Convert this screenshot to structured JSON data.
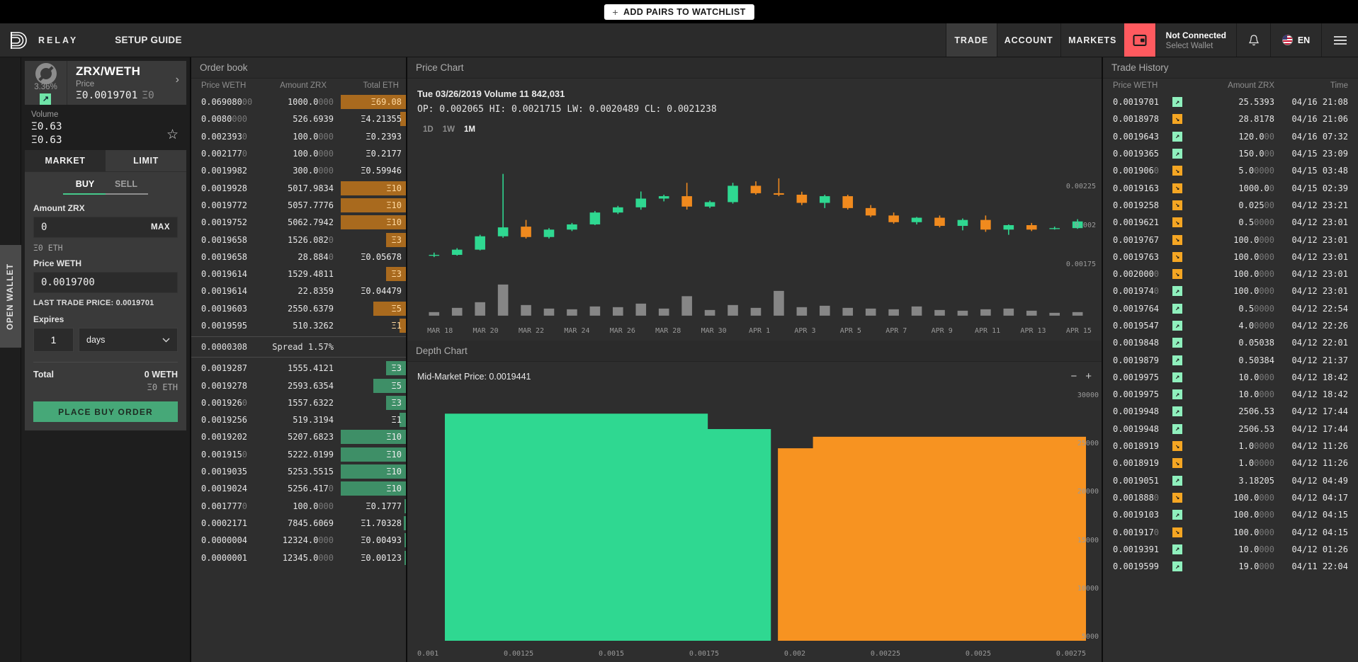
{
  "topstrip": {
    "add_pairs_label": "ADD PAIRS TO WATCHLIST",
    "plus_icon": "+"
  },
  "header": {
    "brand": "RELAY",
    "setup_guide": "SETUP GUIDE",
    "nav": [
      {
        "label": "TRADE",
        "active": true
      },
      {
        "label": "ACCOUNT",
        "active": false
      },
      {
        "label": "MARKETS",
        "active": false
      }
    ],
    "wallet_icon": "wallet-icon",
    "wallet_status_line1": "Not Connected",
    "wallet_status_line2": "Select Wallet",
    "bell_icon": "bell-icon",
    "lang": "EN",
    "menu_icon": "hamburger-icon",
    "accent_wallet": "#ff5a5f"
  },
  "rail": {
    "open_wallet": "OPEN WALLET"
  },
  "left": {
    "pair": {
      "name": "ZRX/WETH",
      "chevron": "›",
      "change_pct": "3.36%",
      "change_arrow": "↗",
      "price_label": "Price",
      "price_value": "Ξ0.0019701",
      "price_secondary": "Ξ0"
    },
    "volume": {
      "label": "Volume",
      "v1": "Ξ0.63",
      "v2": "Ξ0.63",
      "star_icon": "☆"
    },
    "mode_tabs": [
      {
        "label": "MARKET",
        "active": false
      },
      {
        "label": "LIMIT",
        "active": true
      }
    ],
    "side_tabs": [
      {
        "label": "BUY",
        "active": true
      },
      {
        "label": "SELL",
        "active": false
      }
    ],
    "amount_label": "Amount ZRX",
    "amount_value": "0",
    "max_label": "MAX",
    "amount_eth_sub": "Ξ0 ETH",
    "price_label": "Price WETH",
    "price_value": "0.0019700",
    "last_trade_price": "LAST TRADE PRICE: 0.0019701",
    "expires_label": "Expires",
    "expires_value": "1",
    "expires_unit": "days",
    "expires_chevron": "⌄",
    "total_label": "Total",
    "total_value": "0 WETH",
    "total_eth": "Ξ0 ETH",
    "place_order": "PLACE BUY ORDER"
  },
  "orderbook": {
    "title": "Order book",
    "columns": [
      "Price WETH",
      "Amount ZRX",
      "Total ETH"
    ],
    "spread": {
      "price": "0.0000308",
      "text": "Spread 1.57%"
    },
    "asks": [
      {
        "price": "0.069080",
        "price_dim": "00",
        "amount": "1000.0",
        "amount_dim": "000",
        "total": "Ξ69.08",
        "bar": 100
      },
      {
        "price": "0.0080",
        "price_dim": "000",
        "amount": "526.6939",
        "amount_dim": "",
        "total": "Ξ4.21355",
        "bar": 9
      },
      {
        "price": "0.002393",
        "price_dim": "0",
        "amount": "100.0",
        "amount_dim": "000",
        "total": "Ξ0.2393",
        "bar": 0
      },
      {
        "price": "0.002177",
        "price_dim": "0",
        "amount": "100.0",
        "amount_dim": "000",
        "total": "Ξ0.2177",
        "bar": 0
      },
      {
        "price": "0.0019982",
        "price_dim": "",
        "amount": "300.0",
        "amount_dim": "000",
        "total": "Ξ0.59946",
        "bar": 0
      },
      {
        "price": "0.0019928",
        "price_dim": "",
        "amount": "5017.9834",
        "amount_dim": "",
        "total": "Ξ10",
        "bar": 100
      },
      {
        "price": "0.0019772",
        "price_dim": "",
        "amount": "5057.7776",
        "amount_dim": "",
        "total": "Ξ10",
        "bar": 100
      },
      {
        "price": "0.0019752",
        "price_dim": "",
        "amount": "5062.7942",
        "amount_dim": "",
        "total": "Ξ10",
        "bar": 100
      },
      {
        "price": "0.0019658",
        "price_dim": "",
        "amount": "1526.082",
        "amount_dim": "0",
        "total": "Ξ3",
        "bar": 30
      },
      {
        "price": "0.0019658",
        "price_dim": "",
        "amount": "28.884",
        "amount_dim": "0",
        "total": "Ξ0.05678",
        "bar": 0
      },
      {
        "price": "0.0019614",
        "price_dim": "",
        "amount": "1529.4811",
        "amount_dim": "",
        "total": "Ξ3",
        "bar": 30
      },
      {
        "price": "0.0019614",
        "price_dim": "",
        "amount": "22.8359",
        "amount_dim": "",
        "total": "Ξ0.04479",
        "bar": 0
      },
      {
        "price": "0.0019603",
        "price_dim": "",
        "amount": "2550.6379",
        "amount_dim": "",
        "total": "Ξ5",
        "bar": 50
      },
      {
        "price": "0.0019595",
        "price_dim": "",
        "amount": "510.3262",
        "amount_dim": "",
        "total": "Ξ1",
        "bar": 10
      }
    ],
    "bids": [
      {
        "price": "0.0019287",
        "price_dim": "",
        "amount": "1555.4121",
        "amount_dim": "",
        "total": "Ξ3",
        "bar": 30
      },
      {
        "price": "0.0019278",
        "price_dim": "",
        "amount": "2593.6354",
        "amount_dim": "",
        "total": "Ξ5",
        "bar": 50
      },
      {
        "price": "0.001926",
        "price_dim": "0",
        "amount": "1557.6322",
        "amount_dim": "",
        "total": "Ξ3",
        "bar": 30
      },
      {
        "price": "0.0019256",
        "price_dim": "",
        "amount": "519.3194",
        "amount_dim": "",
        "total": "Ξ1",
        "bar": 10
      },
      {
        "price": "0.0019202",
        "price_dim": "",
        "amount": "5207.6823",
        "amount_dim": "",
        "total": "Ξ10",
        "bar": 100
      },
      {
        "price": "0.001915",
        "price_dim": "0",
        "amount": "5222.0199",
        "amount_dim": "",
        "total": "Ξ10",
        "bar": 100
      },
      {
        "price": "0.0019035",
        "price_dim": "",
        "amount": "5253.5515",
        "amount_dim": "",
        "total": "Ξ10",
        "bar": 100
      },
      {
        "price": "0.0019024",
        "price_dim": "",
        "amount": "5256.417",
        "amount_dim": "0",
        "total": "Ξ10",
        "bar": 100
      },
      {
        "price": "0.001777",
        "price_dim": "0",
        "amount": "100.0",
        "amount_dim": "000",
        "total": "Ξ0.1777",
        "bar": 2
      },
      {
        "price": "0.0002171",
        "price_dim": "",
        "amount": "7845.6069",
        "amount_dim": "",
        "total": "Ξ1.70328",
        "bar": 3
      },
      {
        "price": "0.0000004",
        "price_dim": "",
        "amount": "12324.0",
        "amount_dim": "000",
        "total": "Ξ0.00493",
        "bar": 2
      },
      {
        "price": "0.0000001",
        "price_dim": "",
        "amount": "12345.0",
        "amount_dim": "000",
        "total": "Ξ0.00123",
        "bar": 2
      }
    ]
  },
  "pricechart": {
    "title": "Price Chart",
    "info_line1": "Tue 03/26/2019 Volume 11 842,031",
    "info_line2": "OP: 0.002065 HI: 0.0021715 LW: 0.0020489 CL: 0.0021238",
    "timeframes": [
      {
        "label": "1D",
        "active": false
      },
      {
        "label": "1W",
        "active": false
      },
      {
        "label": "1M",
        "active": true
      }
    ]
  },
  "depthchart": {
    "title": "Depth Chart",
    "mid_market": "Mid-Market Price: 0.0019441",
    "zoom_out": "−",
    "zoom_in": "+"
  },
  "tradehistory": {
    "title": "Trade History",
    "columns": [
      "Price WETH",
      "Amount ZRX",
      "Time"
    ],
    "rows": [
      {
        "price": "0.0019701",
        "price_dim": "",
        "dir": "up",
        "amount": "25.5393",
        "amount_dim": "",
        "time": "04/16 21:08"
      },
      {
        "price": "0.0018978",
        "price_dim": "",
        "dir": "down",
        "amount": "28.8178",
        "amount_dim": "",
        "time": "04/16 21:06"
      },
      {
        "price": "0.0019643",
        "price_dim": "",
        "dir": "up",
        "amount": "120.0",
        "amount_dim": "00",
        "time": "04/16 07:32"
      },
      {
        "price": "0.0019365",
        "price_dim": "",
        "dir": "up",
        "amount": "150.0",
        "amount_dim": "00",
        "time": "04/15 23:09"
      },
      {
        "price": "0.001906",
        "price_dim": "0",
        "dir": "down",
        "amount": "5.0",
        "amount_dim": "0000",
        "time": "04/15 03:48"
      },
      {
        "price": "0.0019163",
        "price_dim": "",
        "dir": "down",
        "amount": "1000.0",
        "amount_dim": "0",
        "time": "04/15 02:39"
      },
      {
        "price": "0.0019258",
        "price_dim": "",
        "dir": "down",
        "amount": "0.025",
        "amount_dim": "00",
        "time": "04/12 23:21"
      },
      {
        "price": "0.0019621",
        "price_dim": "",
        "dir": "down",
        "amount": "0.5",
        "amount_dim": "0000",
        "time": "04/12 23:01"
      },
      {
        "price": "0.0019767",
        "price_dim": "",
        "dir": "down",
        "amount": "100.0",
        "amount_dim": "000",
        "time": "04/12 23:01"
      },
      {
        "price": "0.0019763",
        "price_dim": "",
        "dir": "down",
        "amount": "100.0",
        "amount_dim": "000",
        "time": "04/12 23:01"
      },
      {
        "price": "0.002000",
        "price_dim": "0",
        "dir": "down",
        "amount": "100.0",
        "amount_dim": "000",
        "time": "04/12 23:01"
      },
      {
        "price": "0.001974",
        "price_dim": "0",
        "dir": "up",
        "amount": "100.0",
        "amount_dim": "000",
        "time": "04/12 23:01"
      },
      {
        "price": "0.0019764",
        "price_dim": "",
        "dir": "up",
        "amount": "0.5",
        "amount_dim": "0000",
        "time": "04/12 22:54"
      },
      {
        "price": "0.0019547",
        "price_dim": "",
        "dir": "up",
        "amount": "4.0",
        "amount_dim": "0000",
        "time": "04/12 22:26"
      },
      {
        "price": "0.0019848",
        "price_dim": "",
        "dir": "up",
        "amount": "0.05038",
        "amount_dim": "",
        "time": "04/12 22:01"
      },
      {
        "price": "0.0019879",
        "price_dim": "",
        "dir": "up",
        "amount": "0.50384",
        "amount_dim": "",
        "time": "04/12 21:37"
      },
      {
        "price": "0.0019975",
        "price_dim": "",
        "dir": "up",
        "amount": "10.0",
        "amount_dim": "000",
        "time": "04/12 18:42"
      },
      {
        "price": "0.0019975",
        "price_dim": "",
        "dir": "up",
        "amount": "10.0",
        "amount_dim": "000",
        "time": "04/12 18:42"
      },
      {
        "price": "0.0019948",
        "price_dim": "",
        "dir": "up",
        "amount": "2506.53",
        "amount_dim": "",
        "time": "04/12 17:44"
      },
      {
        "price": "0.0019948",
        "price_dim": "",
        "dir": "up",
        "amount": "2506.53",
        "amount_dim": "",
        "time": "04/12 17:44"
      },
      {
        "price": "0.0018919",
        "price_dim": "",
        "dir": "down",
        "amount": "1.0",
        "amount_dim": "0000",
        "time": "04/12 11:26"
      },
      {
        "price": "0.0018919",
        "price_dim": "",
        "dir": "down",
        "amount": "1.0",
        "amount_dim": "0000",
        "time": "04/12 11:26"
      },
      {
        "price": "0.0019051",
        "price_dim": "",
        "dir": "up",
        "amount": "3.18205",
        "amount_dim": "",
        "time": "04/12 04:49"
      },
      {
        "price": "0.001888",
        "price_dim": "0",
        "dir": "down",
        "amount": "100.0",
        "amount_dim": "000",
        "time": "04/12 04:17"
      },
      {
        "price": "0.0019103",
        "price_dim": "",
        "dir": "up",
        "amount": "100.0",
        "amount_dim": "000",
        "time": "04/12 04:15"
      },
      {
        "price": "0.001917",
        "price_dim": "0",
        "dir": "down",
        "amount": "100.0",
        "amount_dim": "000",
        "time": "04/12 04:15"
      },
      {
        "price": "0.0019391",
        "price_dim": "",
        "dir": "up",
        "amount": "10.0",
        "amount_dim": "000",
        "time": "04/12 01:26"
      },
      {
        "price": "0.0019599",
        "price_dim": "",
        "dir": "up",
        "amount": "19.0",
        "amount_dim": "000",
        "time": "04/11 22:04"
      }
    ]
  },
  "chart_data": [
    {
      "type": "candlestick",
      "title": "Price Chart",
      "xlabel": "",
      "ylabel": "",
      "ylim": [
        0.00165,
        0.00235
      ],
      "yticks": [
        "0.00225",
        "0.002",
        "0.00175"
      ],
      "ytick_values": [
        0.00225,
        0.002,
        0.00175
      ],
      "xticks": [
        "MAR 18",
        "MAR 20",
        "MAR 22",
        "MAR 24",
        "MAR 26",
        "MAR 28",
        "MAR 30",
        "APR 1",
        "APR 3",
        "APR 5",
        "APR 7",
        "APR 9",
        "APR 11",
        "APR 13",
        "APR 15"
      ],
      "colors": {
        "up": "#2fd891",
        "down": "#f08a1e",
        "volume": "#9a9a9a"
      },
      "candles": [
        {
          "date": "MAR 17",
          "o": 0.00174,
          "h": 0.00176,
          "l": 0.00173,
          "c": 0.001745,
          "v": 0.1
        },
        {
          "date": "MAR 18",
          "o": 0.001745,
          "h": 0.00179,
          "l": 0.00174,
          "c": 0.00178,
          "v": 0.22
        },
        {
          "date": "MAR 19",
          "o": 0.00178,
          "h": 0.00188,
          "l": 0.001775,
          "c": 0.00187,
          "v": 0.38
        },
        {
          "date": "MAR 20",
          "o": 0.00187,
          "h": 0.00229,
          "l": 0.00186,
          "c": 0.00193,
          "v": 0.88
        },
        {
          "date": "MAR 21",
          "o": 0.001935,
          "h": 0.00198,
          "l": 0.001855,
          "c": 0.001865,
          "v": 0.3
        },
        {
          "date": "MAR 22",
          "o": 0.001865,
          "h": 0.001925,
          "l": 0.001855,
          "c": 0.001915,
          "v": 0.2
        },
        {
          "date": "MAR 23",
          "o": 0.001915,
          "h": 0.00196,
          "l": 0.001905,
          "c": 0.00195,
          "v": 0.18
        },
        {
          "date": "MAR 24",
          "o": 0.00195,
          "h": 0.00204,
          "l": 0.001945,
          "c": 0.00203,
          "v": 0.26
        },
        {
          "date": "MAR 25",
          "o": 0.00203,
          "h": 0.002075,
          "l": 0.00202,
          "c": 0.002065,
          "v": 0.24
        },
        {
          "date": "MAR 26",
          "o": 0.002065,
          "h": 0.0021715,
          "l": 0.0020489,
          "c": 0.0021238,
          "v": 0.34
        },
        {
          "date": "MAR 27",
          "o": 0.002124,
          "h": 0.00215,
          "l": 0.002105,
          "c": 0.00214,
          "v": 0.2
        },
        {
          "date": "MAR 28",
          "o": 0.00214,
          "h": 0.00223,
          "l": 0.00205,
          "c": 0.00207,
          "v": 0.55
        },
        {
          "date": "MAR 29",
          "o": 0.00207,
          "h": 0.00211,
          "l": 0.00206,
          "c": 0.0021,
          "v": 0.16
        },
        {
          "date": "MAR 30",
          "o": 0.0021,
          "h": 0.00223,
          "l": 0.00209,
          "c": 0.00221,
          "v": 0.3
        },
        {
          "date": "MAR 31",
          "o": 0.00221,
          "h": 0.00224,
          "l": 0.00215,
          "c": 0.00216,
          "v": 0.22
        },
        {
          "date": "APR 1",
          "o": 0.00216,
          "h": 0.00226,
          "l": 0.00214,
          "c": 0.00215,
          "v": 0.7
        },
        {
          "date": "APR 2",
          "o": 0.00215,
          "h": 0.00217,
          "l": 0.00208,
          "c": 0.002095,
          "v": 0.24
        },
        {
          "date": "APR 3",
          "o": 0.002095,
          "h": 0.00215,
          "l": 0.00206,
          "c": 0.00214,
          "v": 0.28
        },
        {
          "date": "APR 4",
          "o": 0.00214,
          "h": 0.00215,
          "l": 0.00205,
          "c": 0.00206,
          "v": 0.22
        },
        {
          "date": "APR 5",
          "o": 0.00206,
          "h": 0.00208,
          "l": 0.002,
          "c": 0.00201,
          "v": 0.2
        },
        {
          "date": "APR 6",
          "o": 0.00201,
          "h": 0.00203,
          "l": 0.001955,
          "c": 0.001965,
          "v": 0.18
        },
        {
          "date": "APR 7",
          "o": 0.001965,
          "h": 0.002,
          "l": 0.00195,
          "c": 0.001995,
          "v": 0.26
        },
        {
          "date": "APR 8",
          "o": 0.001995,
          "h": 0.00201,
          "l": 0.00193,
          "c": 0.00194,
          "v": 0.16
        },
        {
          "date": "APR 9",
          "o": 0.00194,
          "h": 0.00199,
          "l": 0.00191,
          "c": 0.00198,
          "v": 0.14
        },
        {
          "date": "APR 10",
          "o": 0.00198,
          "h": 0.00201,
          "l": 0.0019,
          "c": 0.001915,
          "v": 0.18
        },
        {
          "date": "APR 11",
          "o": 0.001915,
          "h": 0.00195,
          "l": 0.00188,
          "c": 0.001945,
          "v": 0.2
        },
        {
          "date": "APR 12",
          "o": 0.001945,
          "h": 0.00196,
          "l": 0.001905,
          "c": 0.001915,
          "v": 0.14
        },
        {
          "date": "APR 15",
          "o": 0.001925,
          "h": 0.001935,
          "l": 0.001915,
          "c": 0.001925,
          "v": 0.08
        },
        {
          "date": "APR 16",
          "o": 0.001925,
          "h": 0.001985,
          "l": 0.00192,
          "c": 0.00197,
          "v": 0.1
        }
      ]
    },
    {
      "type": "area",
      "title": "Depth Chart",
      "annotation": "Mid-Market Price: 0.0019441",
      "xlabel": "",
      "ylabel": "",
      "xticks": [
        "0.001",
        "0.00125",
        "0.0015",
        "0.00175",
        "0.002",
        "0.00225",
        "0.0025",
        "0.00275"
      ],
      "xtick_values": [
        0.001,
        0.00125,
        0.0015,
        0.00175,
        0.002,
        0.00225,
        0.0025,
        0.00275
      ],
      "yticks": [
        "30000",
        "25000",
        "20000",
        "15000",
        "10000",
        "5000"
      ],
      "ytick_values": [
        30000,
        25000,
        20000,
        15000,
        10000,
        5000
      ],
      "ylim": [
        0,
        32000
      ],
      "colors": {
        "bid": "#2fd891",
        "ask": "#f79321"
      },
      "series": [
        {
          "name": "bids",
          "x": [
            0.001,
            0.00175,
            0.00175,
            0.00193,
            0.00193,
            0.00194
          ],
          "y": [
            29500,
            29500,
            27500,
            27500,
            0,
            0
          ]
        },
        {
          "name": "asks",
          "x": [
            0.00195,
            0.00195,
            0.00205,
            0.00205,
            0.00285
          ],
          "y": [
            0,
            25000,
            25000,
            26500,
            26500
          ]
        }
      ]
    }
  ]
}
